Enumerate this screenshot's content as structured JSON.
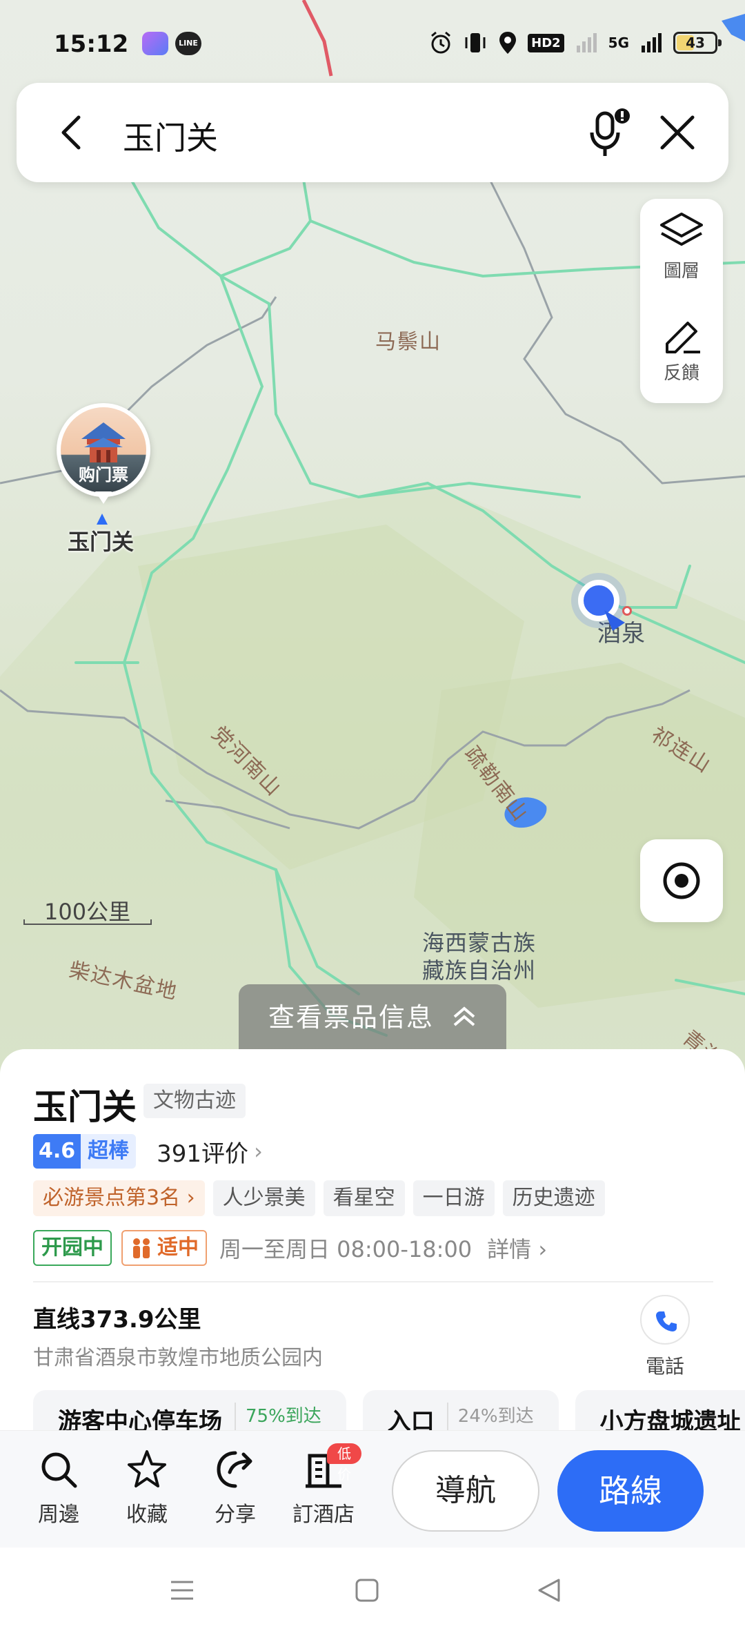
{
  "status_bar": {
    "time": "15:12",
    "network": "5G",
    "battery": "43",
    "hd_label": "HD2"
  },
  "search": {
    "query": "玉门关"
  },
  "map": {
    "tools": [
      {
        "icon": "layers-icon",
        "label": "圖層"
      },
      {
        "icon": "feedback-edit-icon",
        "label": "反饋"
      }
    ],
    "poi": {
      "badge": "购门票",
      "name": "玉门关"
    },
    "labels": {
      "mazongshan": "马鬃山",
      "jiuquan": "酒泉",
      "danghenanshan": "党河南山",
      "shulenanshan": "疏勒南山",
      "qilianshan": "祁连山",
      "haixi_line1": "海西蒙古族",
      "haixi_line2": "藏族自治州",
      "chaidamu": "柴达木盆地",
      "qinghai": "青海"
    },
    "scale": "100公里",
    "ticket_tab": "查看票品信息"
  },
  "place": {
    "title": "玉门关",
    "category": "文物古迹",
    "rating": "4.6",
    "rating_word": "超棒",
    "reviews": "391评价",
    "rank_tag": "必游景点第3名",
    "tags": [
      "人少景美",
      "看星空",
      "一日游",
      "历史遗迹"
    ],
    "open_status": "开园中",
    "crowd_status": "适中",
    "hours": "周一至周日 08:00-18:00",
    "details": "詳情",
    "distance": "直线373.9公里",
    "address": "甘肃省酒泉市敦煌市地质公园内",
    "phone_label": "電話",
    "entries": [
      {
        "name": "游客中心停车场",
        "pct": "75%到达"
      },
      {
        "name": "入口",
        "pct": "24%到达"
      },
      {
        "name": "小方盘城遗址",
        "pct": ""
      }
    ]
  },
  "actions": {
    "nearby": "周邊",
    "favorite": "收藏",
    "share": "分享",
    "hotel": "訂酒店",
    "hotel_badge": "低价",
    "navigate": "導航",
    "route": "路線"
  },
  "colors": {
    "accent": "#2d6df6",
    "road": "#7fdbb0",
    "open_green": "#2e9a4c",
    "crowd_orange": "#e06a2a",
    "badge_red": "#f04848"
  }
}
